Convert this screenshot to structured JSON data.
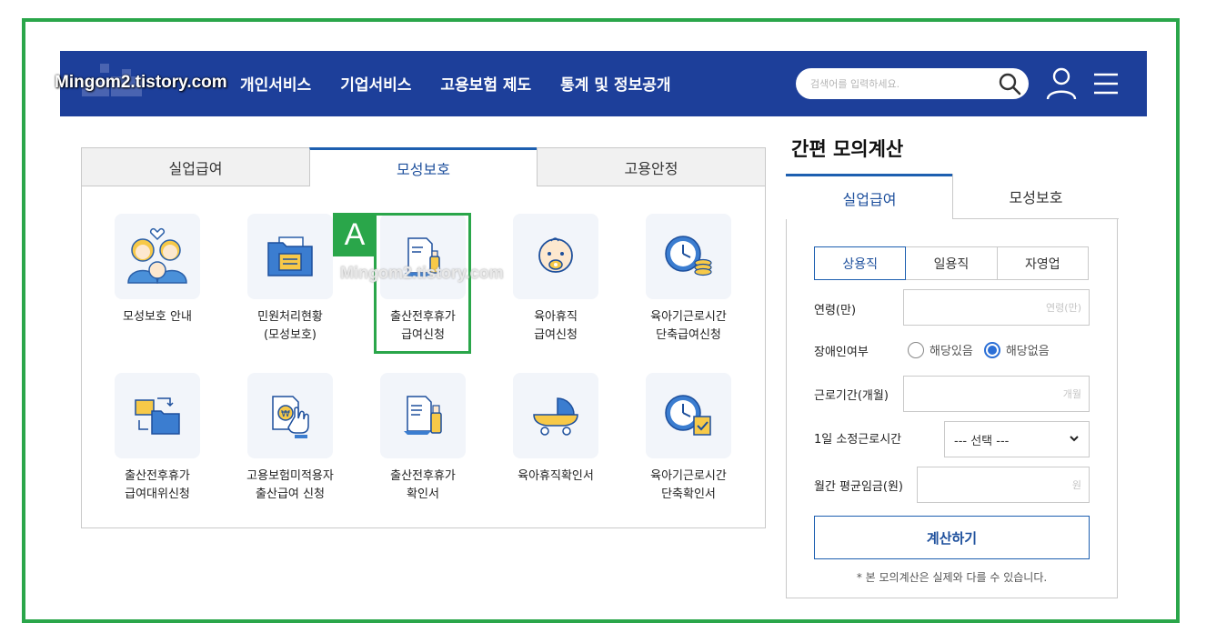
{
  "header": {
    "watermark": "Mingom2.tistory.com",
    "nav": [
      "개인서비스",
      "기업서비스",
      "고용보험 제도",
      "통계 및 정보공개"
    ],
    "search_placeholder": "검색어를 입력하세요."
  },
  "main_tabs": [
    {
      "label": "실업급여",
      "active": false
    },
    {
      "label": "모성보호",
      "active": true
    },
    {
      "label": "고용안정",
      "active": false
    }
  ],
  "services": [
    {
      "label": "모성보호 안내",
      "icon": "family-icon"
    },
    {
      "label": "민원처리현황\n(모성보호)",
      "icon": "folder-document-icon"
    },
    {
      "label": "출산전후휴가\n급여신청",
      "icon": "document-baby-bottle-icon"
    },
    {
      "label": "육아휴직\n급여신청",
      "icon": "baby-face-icon"
    },
    {
      "label": "육아기근로시간\n단축급여신청",
      "icon": "clock-coins-icon"
    },
    {
      "label": "출산전후휴가\n급여대위신청",
      "icon": "folder-transfer-icon"
    },
    {
      "label": "고용보험미적용자\n출산급여 신청",
      "icon": "document-won-hand-icon"
    },
    {
      "label": "출산전후휴가\n확인서",
      "icon": "document-bottle-icon"
    },
    {
      "label": "육아휴직확인서",
      "icon": "stroller-icon"
    },
    {
      "label": "육아기근로시간\n단축확인서",
      "icon": "clock-check-icon"
    }
  ],
  "annotation": {
    "badge": "A",
    "watermark": "Mingom2.tistory.com"
  },
  "calculator": {
    "title": "간편 모의계산",
    "tabs": [
      {
        "label": "실업급여",
        "active": true
      },
      {
        "label": "모성보호",
        "active": false
      }
    ],
    "employment_types": [
      {
        "label": "상용직",
        "active": true
      },
      {
        "label": "일용직",
        "active": false
      },
      {
        "label": "자영업",
        "active": false
      }
    ],
    "age_label": "연령(만)",
    "age_placeholder": "연령(만)",
    "disability_label": "장애인여부",
    "disability_options": [
      {
        "label": "해당있음",
        "checked": false
      },
      {
        "label": "해당없음",
        "checked": true
      }
    ],
    "work_period_label": "근로기간(개월)",
    "work_period_placeholder": "개월",
    "daily_hours_label": "1일 소정근로시간",
    "daily_hours_selected": "--- 선택 ---",
    "wage_label": "월간 평균임금(원)",
    "wage_placeholder": "원",
    "submit_label": "계산하기",
    "note": "* 본 모의계산은 실제와 다를 수 있습니다."
  },
  "colors": {
    "header_bg": "#1d3f9a",
    "accent": "#1d5fb0",
    "frame_green": "#2aa64a"
  }
}
